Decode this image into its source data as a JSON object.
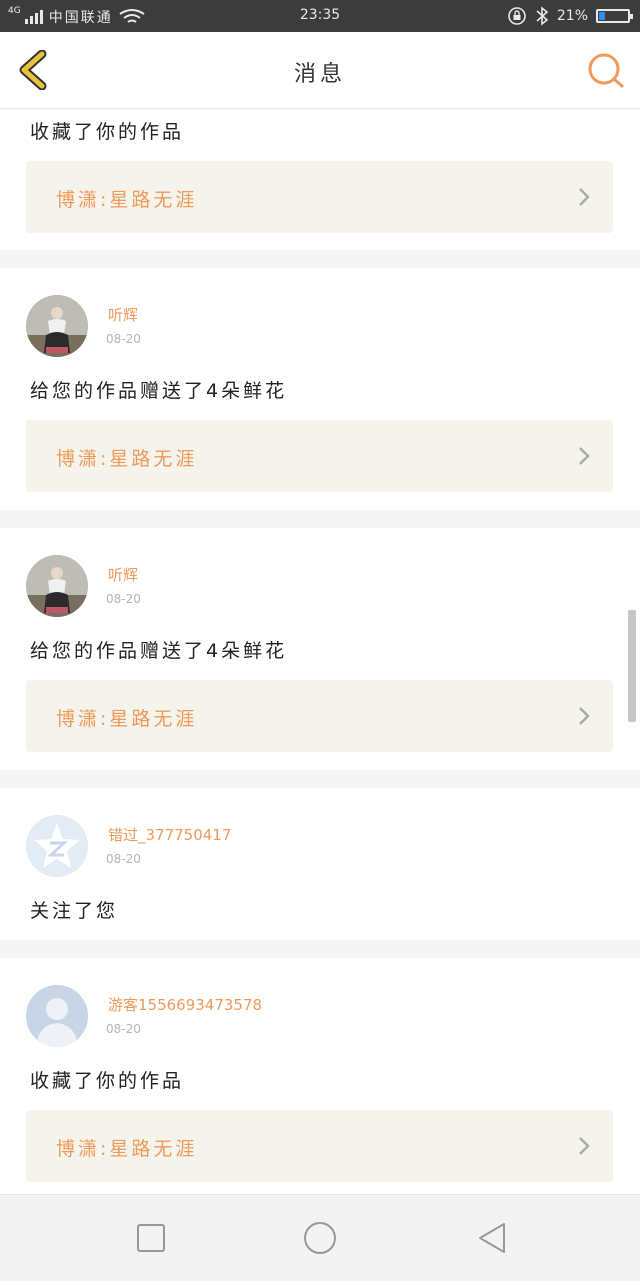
{
  "status_bar": {
    "network": "4G",
    "carrier": "中国联通",
    "time": "23:35",
    "battery": "21%",
    "battery_level": 0.21,
    "icons": [
      "signal-icon",
      "wifi-icon",
      "rotation-lock-icon",
      "bluetooth-icon",
      "battery-icon"
    ]
  },
  "header": {
    "title": "消息",
    "back_icon": "chevron-left-icon",
    "search_icon": "search-icon"
  },
  "feed": {
    "partial_item": {
      "action": "收藏了你的作品",
      "work_title": "博潇:星路无涯"
    },
    "items": [
      {
        "username": "听辉",
        "date": "08-20",
        "action": "给您的作品赠送了4朵鲜花",
        "work_title": "博潇:星路无涯",
        "avatar": "photo-avatar"
      },
      {
        "username": "听辉",
        "date": "08-20",
        "action": "给您的作品赠送了4朵鲜花",
        "work_title": "博潇:星路无涯",
        "avatar": "photo-avatar"
      },
      {
        "username": "错过_377750417",
        "date": "08-20",
        "action": "关注了您",
        "work_title": "",
        "avatar": "qzone-avatar"
      },
      {
        "username": "游客1556693473578",
        "date": "08-20",
        "action": "收藏了你的作品",
        "work_title": "博潇:星路无涯",
        "avatar": "default-person-avatar"
      }
    ]
  },
  "navbar": {
    "buttons": [
      "recent-apps-icon",
      "home-icon",
      "back-icon"
    ]
  },
  "colors": {
    "accent": "#ef9a5a",
    "back_arrow": "#e8c23a",
    "work_bg": "#f4f4ec",
    "status_bg": "#3c3c3c"
  }
}
